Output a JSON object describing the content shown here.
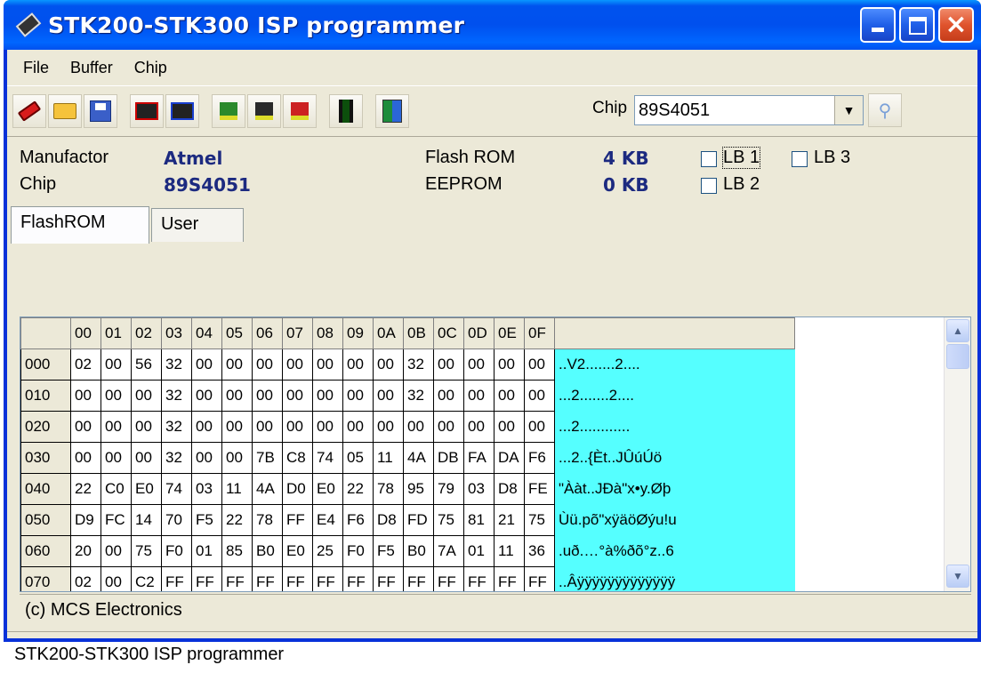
{
  "window": {
    "title": "STK200-STK300 ISP programmer"
  },
  "menu": [
    {
      "label": "File"
    },
    {
      "label": "Buffer"
    },
    {
      "label": "Chip"
    }
  ],
  "toolbar": {
    "buttons": [
      "clear-buffer",
      "open-file",
      "save-file",
      "read-chip",
      "write-chip",
      "verify",
      "erase",
      "lock",
      "autoprogram",
      "exit"
    ],
    "chip_label": "Chip",
    "chip_value": "89S4051"
  },
  "info": {
    "manufactor_label": "Manufactor",
    "manufactor_value": "Atmel",
    "chip_label": "Chip",
    "chip_value": "89S4051",
    "flash_label": "Flash ROM",
    "flash_value": "4 KB",
    "eeprom_label": "EEPROM",
    "eeprom_value": "0 KB",
    "lb1": "LB 1",
    "lb2": "LB 2",
    "lb3": "LB 3"
  },
  "tabs": [
    {
      "label": "FlashROM"
    },
    {
      "label": "User"
    }
  ],
  "hex": {
    "columns": [
      "00",
      "01",
      "02",
      "03",
      "04",
      "05",
      "06",
      "07",
      "08",
      "09",
      "0A",
      "0B",
      "0C",
      "0D",
      "0E",
      "0F"
    ],
    "rows": [
      {
        "addr": "000",
        "bytes": [
          "02",
          "00",
          "56",
          "32",
          "00",
          "00",
          "00",
          "00",
          "00",
          "00",
          "00",
          "32",
          "00",
          "00",
          "00",
          "00"
        ],
        "ascii": "..V2.......2...."
      },
      {
        "addr": "010",
        "bytes": [
          "00",
          "00",
          "00",
          "32",
          "00",
          "00",
          "00",
          "00",
          "00",
          "00",
          "00",
          "32",
          "00",
          "00",
          "00",
          "00"
        ],
        "ascii": "...2.......2...."
      },
      {
        "addr": "020",
        "bytes": [
          "00",
          "00",
          "00",
          "32",
          "00",
          "00",
          "00",
          "00",
          "00",
          "00",
          "00",
          "00",
          "00",
          "00",
          "00",
          "00"
        ],
        "ascii": "...2............"
      },
      {
        "addr": "030",
        "bytes": [
          "00",
          "00",
          "00",
          "32",
          "00",
          "00",
          "7B",
          "C8",
          "74",
          "05",
          "11",
          "4A",
          "DB",
          "FA",
          "DA",
          "F6"
        ],
        "ascii": "...2..{Èt..JÛúÚö"
      },
      {
        "addr": "040",
        "bytes": [
          "22",
          "C0",
          "E0",
          "74",
          "03",
          "11",
          "4A",
          "D0",
          "E0",
          "22",
          "78",
          "95",
          "79",
          "03",
          "D8",
          "FE"
        ],
        "ascii": "\"Ààt..JÐà\"x•y.Øþ"
      },
      {
        "addr": "050",
        "bytes": [
          "D9",
          "FC",
          "14",
          "70",
          "F5",
          "22",
          "78",
          "FF",
          "E4",
          "F6",
          "D8",
          "FD",
          "75",
          "81",
          "21",
          "75"
        ],
        "ascii": "Ùü.põ\"xÿäöØýu!u"
      },
      {
        "addr": "060",
        "bytes": [
          "20",
          "00",
          "75",
          "F0",
          "01",
          "85",
          "B0",
          "E0",
          "25",
          "F0",
          "F5",
          "B0",
          "7A",
          "01",
          "11",
          "36"
        ],
        "ascii": " .uð.…°à%ðõ°z..6"
      },
      {
        "addr": "070",
        "bytes": [
          "02",
          "00",
          "C2",
          "FF",
          "FF",
          "FF",
          "FF",
          "FF",
          "FF",
          "FF",
          "FF",
          "FF",
          "FF",
          "FF",
          "FF",
          "FF"
        ],
        "ascii": "..Âÿÿÿÿÿÿÿÿÿÿÿÿÿ"
      }
    ]
  },
  "copyright": "(c) MCS Electronics",
  "status": "STK200-STK300 ISP programmer"
}
